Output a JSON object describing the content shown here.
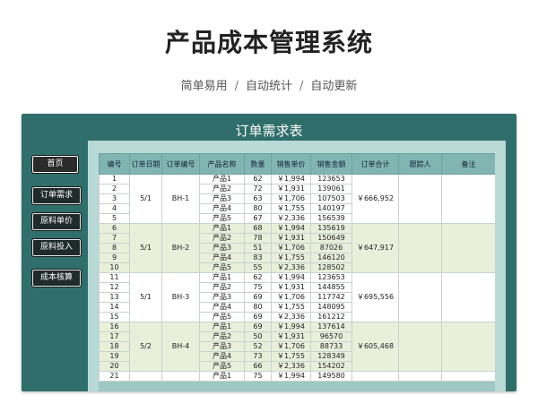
{
  "hero": {
    "title": "产品成本管理系统",
    "sub": [
      "简单易用",
      "自动统计",
      "自动更新"
    ],
    "sep": "/"
  },
  "sheet": {
    "title": "订单需求表",
    "sidebar": [
      "首页",
      "订单需求",
      "原料单价",
      "原料投入",
      "成本核算"
    ],
    "headers": [
      "编号",
      "订单日期",
      "订单编号",
      "产品名称",
      "数量",
      "销售单价",
      "销售金额",
      "订单合计",
      "跟踪人",
      "备注"
    ],
    "rows": [
      [
        "1",
        "产品1",
        "62",
        "￥1,994",
        "123653"
      ],
      [
        "2",
        "产品2",
        "72",
        "￥1,931",
        "139061"
      ],
      [
        "3",
        "产品3",
        "63",
        "￥1,706",
        "107503"
      ],
      [
        "4",
        "产品4",
        "80",
        "￥1,755",
        "140197"
      ],
      [
        "5",
        "产品5",
        "67",
        "￥2,336",
        "156539"
      ],
      [
        "6",
        "产品1",
        "68",
        "￥1,994",
        "135619"
      ],
      [
        "7",
        "产品2",
        "78",
        "￥1,931",
        "150649"
      ],
      [
        "8",
        "产品3",
        "51",
        "￥1,706",
        "87026"
      ],
      [
        "9",
        "产品4",
        "83",
        "￥1,755",
        "146120"
      ],
      [
        "10",
        "产品5",
        "55",
        "￥2,336",
        "128502"
      ],
      [
        "11",
        "产品1",
        "62",
        "￥1,994",
        "123653"
      ],
      [
        "12",
        "产品2",
        "75",
        "￥1,931",
        "144855"
      ],
      [
        "13",
        "产品3",
        "69",
        "￥1,706",
        "117742"
      ],
      [
        "14",
        "产品4",
        "80",
        "￥1,755",
        "148095"
      ],
      [
        "15",
        "产品5",
        "69",
        "￥2,336",
        "161212"
      ],
      [
        "16",
        "产品1",
        "69",
        "￥1,994",
        "137614"
      ],
      [
        "17",
        "产品2",
        "50",
        "￥1,931",
        "96570"
      ],
      [
        "18",
        "产品3",
        "52",
        "￥1,706",
        "88733"
      ],
      [
        "19",
        "产品4",
        "73",
        "￥1,755",
        "128349"
      ],
      [
        "20",
        "产品5",
        "66",
        "￥2,336",
        "154202"
      ],
      [
        "21",
        "产品1",
        "75",
        "￥1,994",
        "149580"
      ]
    ],
    "groups": [
      {
        "date": "5/1",
        "order": "BH-1",
        "total": "￥666,952"
      },
      {
        "date": "5/1",
        "order": "BH-2",
        "total": "￥647,917"
      },
      {
        "date": "5/1",
        "order": "BH-3",
        "total": "￥695,556"
      },
      {
        "date": "5/2",
        "order": "BH-4",
        "total": "￥605,468"
      }
    ]
  }
}
